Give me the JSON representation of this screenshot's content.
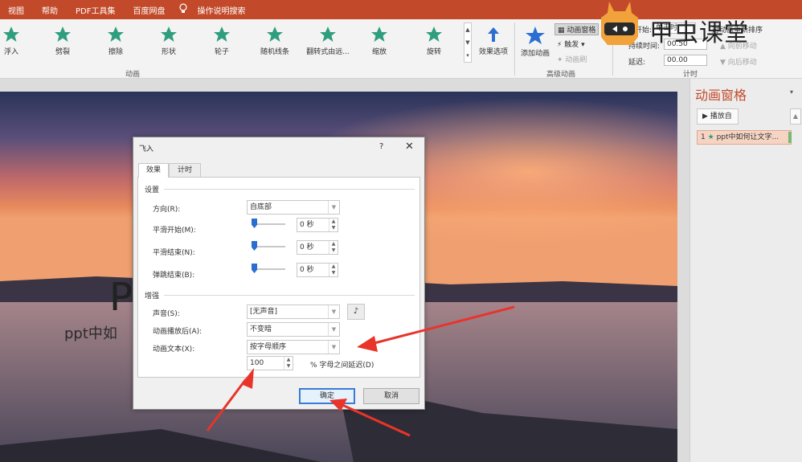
{
  "menubar": {
    "items": [
      "视图",
      "帮助",
      "PDF工具集",
      "百度网盘",
      "操作说明搜索"
    ],
    "bg": "#c24a2a"
  },
  "ribbon": {
    "effects": [
      {
        "label": "浮入",
        "icon": "float-in-star-icon"
      },
      {
        "label": "劈裂",
        "icon": "split-star-icon"
      },
      {
        "label": "擦除",
        "icon": "wipe-star-icon"
      },
      {
        "label": "形状",
        "icon": "shape-star-icon"
      },
      {
        "label": "轮子",
        "icon": "wheel-star-icon"
      },
      {
        "label": "随机线条",
        "icon": "random-bars-star-icon"
      },
      {
        "label": "翻转式由远...",
        "icon": "grow-turn-star-icon"
      },
      {
        "label": "缩放",
        "icon": "zoom-star-icon"
      },
      {
        "label": "旋转",
        "icon": "swivel-star-icon"
      }
    ],
    "effect_options": "效果选项",
    "add_animation": "添加动画",
    "animation_pane_btn": "动画窗格",
    "trigger": "触发",
    "animation_painter": "动画刷",
    "group_animation": "动画",
    "group_advanced": "高级动画",
    "group_timing": "计时",
    "start_label": "开始:",
    "start_value": "单击时",
    "duration_label": "持续时间:",
    "duration_value": "00.50",
    "delay_label": "延迟:",
    "delay_value": "00.00",
    "reorder": "对动画重新排序",
    "move_earlier": "向前移动",
    "move_later": "向后移动",
    "accent_star": "#2e9e7e",
    "blue_star": "#2b6ed1"
  },
  "logo": {
    "text": "甲虫课堂",
    "color": "#f2a23a"
  },
  "slide": {
    "title": "P",
    "subtitle": "ppt中如"
  },
  "anim_pane": {
    "title": "动画窗格",
    "play_btn": "播放自",
    "item_number": "1",
    "item_label": "ppt中如何让文字..."
  },
  "dialog": {
    "title": "飞入",
    "help": "?",
    "close": "✕",
    "tabs": [
      "效果",
      "计时"
    ],
    "section_settings": "设置",
    "direction_label": "方向(R):",
    "direction_value": "自底部",
    "smooth_start_label": "平滑开始(M):",
    "smooth_start_value": "0 秒",
    "smooth_end_label": "平滑结束(N):",
    "smooth_end_value": "0 秒",
    "bounce_end_label": "弹跳结束(B):",
    "bounce_end_value": "0 秒",
    "section_enhance": "增强",
    "sound_label": "声音(S):",
    "sound_value": "[无声音]",
    "after_label": "动画播放后(A):",
    "after_value": "不变暗",
    "animate_text_label": "动画文本(X):",
    "animate_text_value": "按字母顺序",
    "delay_value": "100",
    "delay_suffix": "% 字母之间延迟(D)",
    "ok": "确定",
    "cancel": "取消"
  },
  "annotation_color": "#e8342a"
}
